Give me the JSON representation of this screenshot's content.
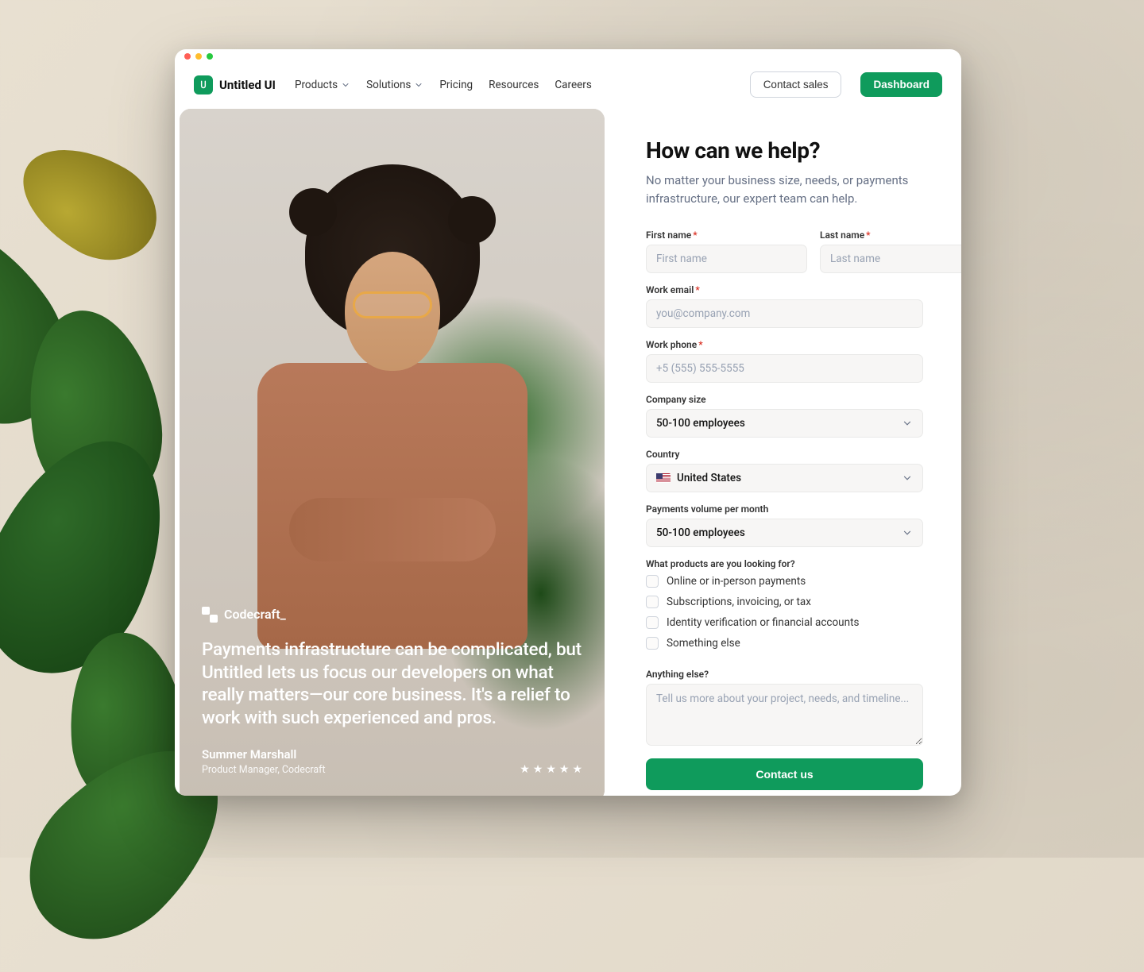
{
  "brand": {
    "name": "Untitled UI"
  },
  "nav": {
    "products": "Products",
    "solutions": "Solutions",
    "pricing": "Pricing",
    "resources": "Resources",
    "careers": "Careers"
  },
  "header_actions": {
    "contact_sales": "Contact sales",
    "dashboard": "Dashboard"
  },
  "hero": {
    "brand": "Codecraft_",
    "quote": "Payments infrastructure can be complicated, but Untitled lets us focus our developers on what really matters—our core business. It's a relief to work with such experienced and pros.",
    "author_name": "Summer Marshall",
    "author_title": "Product Manager, Codecraft",
    "rating": 5
  },
  "form": {
    "title": "How can we help?",
    "subtitle": "No matter your business size, needs, or payments infrastructure, our expert team can help.",
    "first_name": {
      "label": "First name",
      "placeholder": "First name",
      "required": true
    },
    "last_name": {
      "label": "Last name",
      "placeholder": "Last name",
      "required": true
    },
    "email": {
      "label": "Work email",
      "placeholder": "you@company.com",
      "required": true
    },
    "phone": {
      "label": "Work phone",
      "placeholder": "+5 (555) 555-5555",
      "required": true
    },
    "company_size": {
      "label": "Company size",
      "value": "50-100 employees"
    },
    "country": {
      "label": "Country",
      "value": "United States"
    },
    "volume": {
      "label": "Payments volume per month",
      "value": "50-100 employees"
    },
    "products_label": "What products are you looking for?",
    "products": {
      "opt1": "Online or in-person payments",
      "opt2": "Subscriptions, invoicing, or tax",
      "opt3": "Identity verification or financial accounts",
      "opt4": "Something else"
    },
    "anything_else": {
      "label": "Anything else?",
      "placeholder": "Tell us more about your project, needs, and timeline..."
    },
    "submit": "Contact us"
  },
  "colors": {
    "primary": "#0f9b5c",
    "error": "#d92d20"
  }
}
